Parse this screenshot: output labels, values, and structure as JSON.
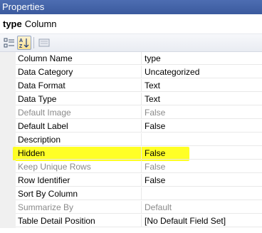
{
  "window": {
    "title": "Properties"
  },
  "object": {
    "name": "type",
    "type": "Column"
  },
  "toolbar": {
    "buttons": [
      {
        "icon": "categorized-icon"
      },
      {
        "icon": "alphabetical-sort-icon",
        "pressed": true
      },
      {
        "icon": "property-pages-icon"
      }
    ]
  },
  "properties": [
    {
      "name": "Column Name",
      "value": "type",
      "enabled": true
    },
    {
      "name": "Data Category",
      "value": "Uncategorized",
      "enabled": true
    },
    {
      "name": "Data Format",
      "value": "Text",
      "enabled": true
    },
    {
      "name": "Data Type",
      "value": "Text",
      "enabled": true
    },
    {
      "name": "Default Image",
      "value": "False",
      "enabled": false
    },
    {
      "name": "Default Label",
      "value": "False",
      "enabled": true
    },
    {
      "name": "Description",
      "value": "",
      "enabled": true
    },
    {
      "name": "Hidden",
      "value": "False",
      "enabled": true,
      "highlighted": true
    },
    {
      "name": "Keep Unique Rows",
      "value": "False",
      "enabled": false
    },
    {
      "name": "Row Identifier",
      "value": "False",
      "enabled": true
    },
    {
      "name": "Sort By Column",
      "value": "",
      "enabled": true
    },
    {
      "name": "Summarize By",
      "value": "Default",
      "enabled": false
    },
    {
      "name": "Table Detail Position",
      "value": "[No Default Field Set]",
      "enabled": true
    }
  ],
  "colors": {
    "title_bar": "#3b5a9e",
    "highlight": "#ffff00",
    "disabled_text": "#8a8a8a"
  }
}
